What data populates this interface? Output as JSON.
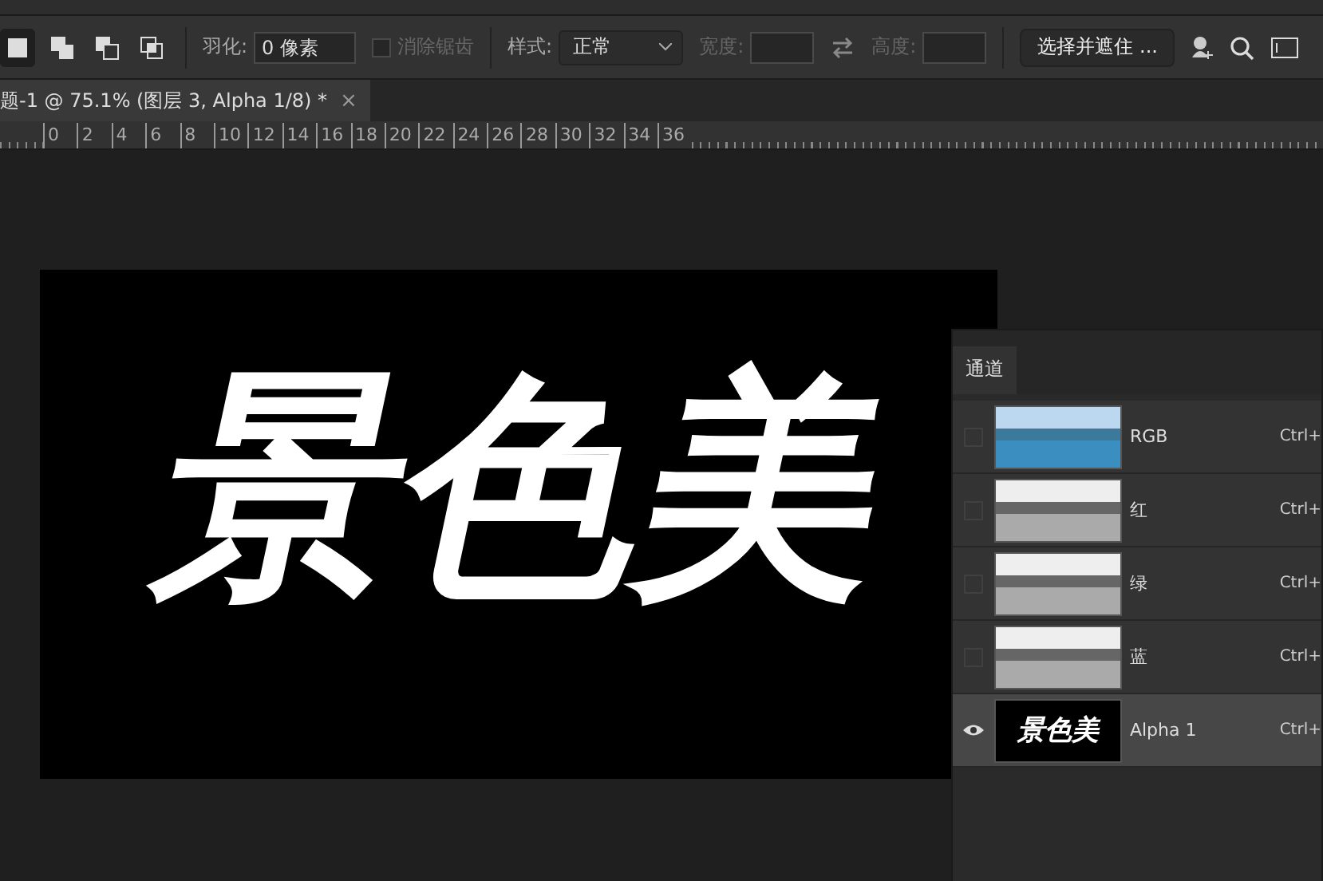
{
  "options_bar": {
    "selection_modes": [
      {
        "selected": true
      },
      {
        "selected": false
      },
      {
        "selected": false
      },
      {
        "selected": false
      }
    ],
    "feather": {
      "label": "羽化:",
      "value": "0 像素"
    },
    "antialias": {
      "label": "消除锯齿",
      "checked": false,
      "disabled": true
    },
    "style": {
      "label": "样式:",
      "value": "正常"
    },
    "width": {
      "label": "宽度:"
    },
    "height": {
      "label": "高度:"
    },
    "select_mask_button": "选择并遮住 ..."
  },
  "document_tab": {
    "title": "题-1 @ 75.1% (图层 3, Alpha 1/8) *",
    "close": "×"
  },
  "ruler": [
    "0",
    "2",
    "4",
    "6",
    "8",
    "10",
    "12",
    "14",
    "16",
    "18",
    "20",
    "22",
    "24",
    "26",
    "28",
    "30",
    "32",
    "34",
    "36"
  ],
  "canvas": {
    "text": "景色美"
  },
  "channels_panel": {
    "tab": "通道",
    "channels": [
      {
        "name": "RGB",
        "shortcut": "Ctrl+",
        "visible": false,
        "selected": false,
        "kind": "color"
      },
      {
        "name": "红",
        "shortcut": "Ctrl+",
        "visible": false,
        "selected": false,
        "kind": "gray"
      },
      {
        "name": "绿",
        "shortcut": "Ctrl+",
        "visible": false,
        "selected": false,
        "kind": "gray"
      },
      {
        "name": "蓝",
        "shortcut": "Ctrl+",
        "visible": false,
        "selected": false,
        "kind": "gray"
      },
      {
        "name": "Alpha 1",
        "shortcut": "Ctrl+",
        "visible": true,
        "selected": true,
        "kind": "alpha",
        "thumb_text": "景色美"
      }
    ]
  }
}
